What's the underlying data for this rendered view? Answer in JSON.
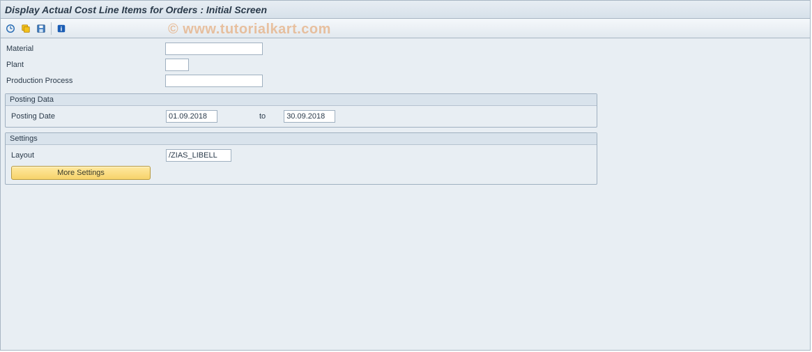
{
  "titlebar": {
    "title": "Display Actual Cost Line Items for Orders : Initial Screen"
  },
  "toolbar": {
    "icons": {
      "execute": "execute-icon",
      "variants": "variant-icon",
      "save": "save-icon",
      "info": "info-icon"
    }
  },
  "fields": {
    "material_label": "Material",
    "material_value": "",
    "plant_label": "Plant",
    "plant_value": "",
    "process_label": "Production Process",
    "process_value": ""
  },
  "posting": {
    "group_title": "Posting Data",
    "date_label": "Posting Date",
    "from_value": "01.09.2018",
    "to_label": "to",
    "to_value": "30.09.2018"
  },
  "settings": {
    "group_title": "Settings",
    "layout_label": "Layout",
    "layout_value": "/ZIAS_LIBELL",
    "more_btn": "More Settings"
  },
  "watermark": "© www.tutorialkart.com"
}
